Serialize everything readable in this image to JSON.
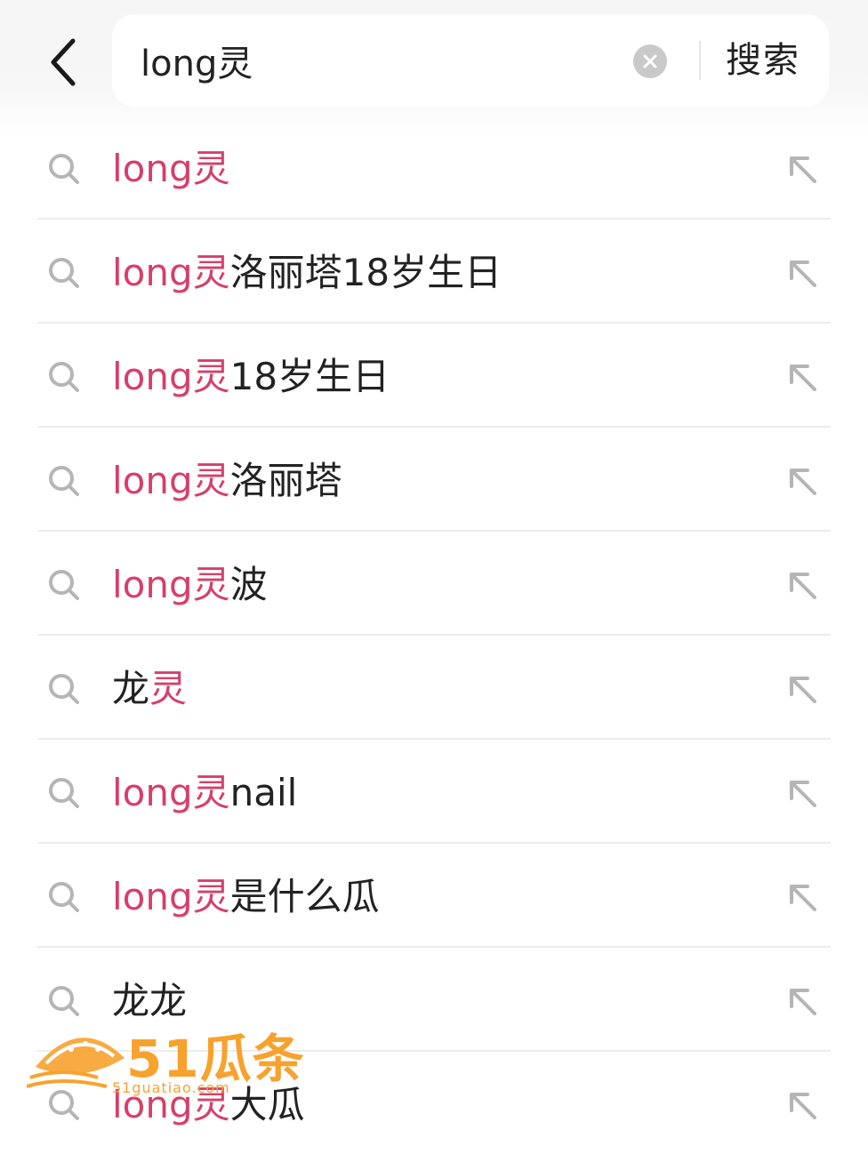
{
  "search": {
    "value": "long灵",
    "button_label": "搜索"
  },
  "suggestions": [
    {
      "highlight": "long灵",
      "rest": ""
    },
    {
      "highlight": "long灵",
      "rest": "洛丽塔18岁生日"
    },
    {
      "highlight": "long灵",
      "rest": "18岁生日"
    },
    {
      "highlight": "long灵",
      "rest": "洛丽塔"
    },
    {
      "highlight": "long灵",
      "rest": "波"
    },
    {
      "prefix": "龙",
      "highlight": "灵",
      "rest": ""
    },
    {
      "highlight": "long灵",
      "rest": "nail"
    },
    {
      "highlight": "long灵",
      "rest": "是什么瓜"
    },
    {
      "prefix": "龙龙",
      "highlight": "",
      "rest": ""
    },
    {
      "highlight": "long灵",
      "rest": "大瓜"
    }
  ],
  "watermark": {
    "brand": "51瓜条",
    "url": "51guatiao.com"
  },
  "colors": {
    "highlight": "#d63f6a",
    "watermark": "#f7a22d"
  },
  "icons": {
    "back": "chevron-left-icon",
    "clear": "clear-circle-icon",
    "suggestion": "search-icon",
    "fill": "arrow-up-left-icon"
  }
}
